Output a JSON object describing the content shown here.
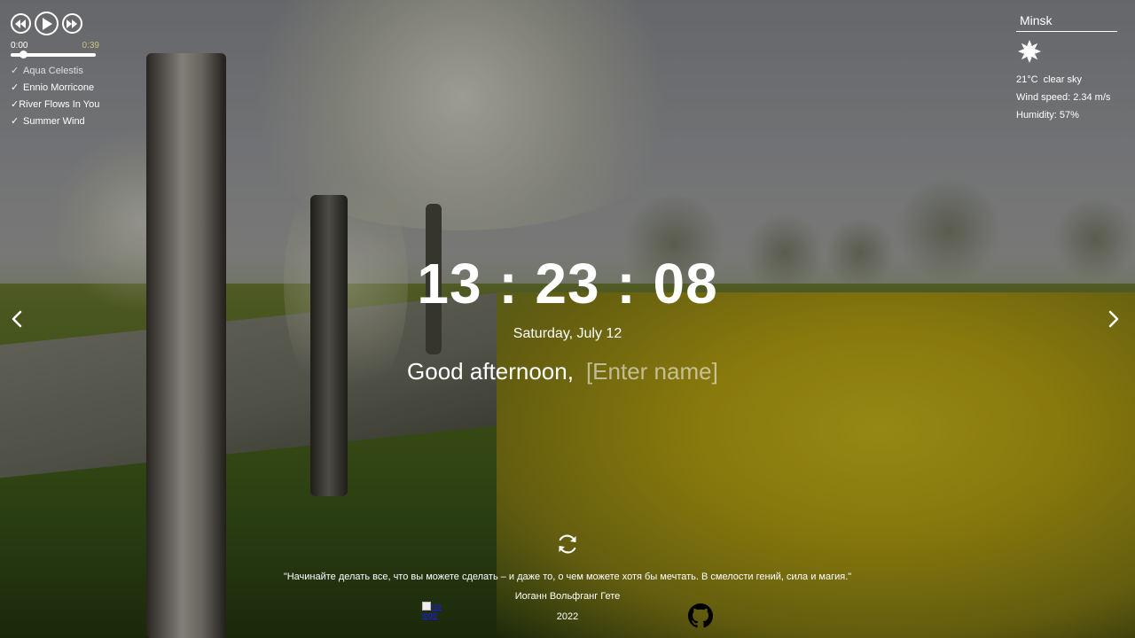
{
  "player": {
    "current_time": "0:00",
    "duration": "0:39",
    "progress_fraction": 0.1,
    "playlist": [
      {
        "title": "Aqua Celestis",
        "checked": true,
        "dim": true
      },
      {
        "title": "Ennio Morricone",
        "checked": true,
        "dim": false
      },
      {
        "title": "River Flows In You",
        "checked": true,
        "dim": false
      },
      {
        "title": "Summer Wind",
        "checked": true,
        "dim": false
      }
    ],
    "check_glyph": "✓",
    "icons": {
      "prev": "play-prev-icon",
      "play": "play-icon",
      "next": "play-next-icon"
    }
  },
  "weather": {
    "city": "Minsk",
    "icon": "sun-icon",
    "temperature": "21°C",
    "description": "clear sky",
    "wind": "Wind speed: 2.34 m/s",
    "humidity": "Humidity: 57%"
  },
  "clock": {
    "time": "13 : 23 : 08",
    "date": "Saturday, July 12"
  },
  "greeting": {
    "text": "Good afternoon,",
    "name_placeholder": "[Enter name]",
    "name_value": ""
  },
  "quote": {
    "text": "\"Начинайте делать все, что вы можете сделать – и даже то, о чем можете хотя бы мечтать. В смелости гений, сила и магия.\"",
    "author": "Иоганн Вольфганг Гете"
  },
  "footer": {
    "rss_alt": "rss logo",
    "year": "2022",
    "github_icon": "github-icon"
  },
  "colors": {
    "text": "#ffffff",
    "duration_text": "#c9c07a"
  }
}
